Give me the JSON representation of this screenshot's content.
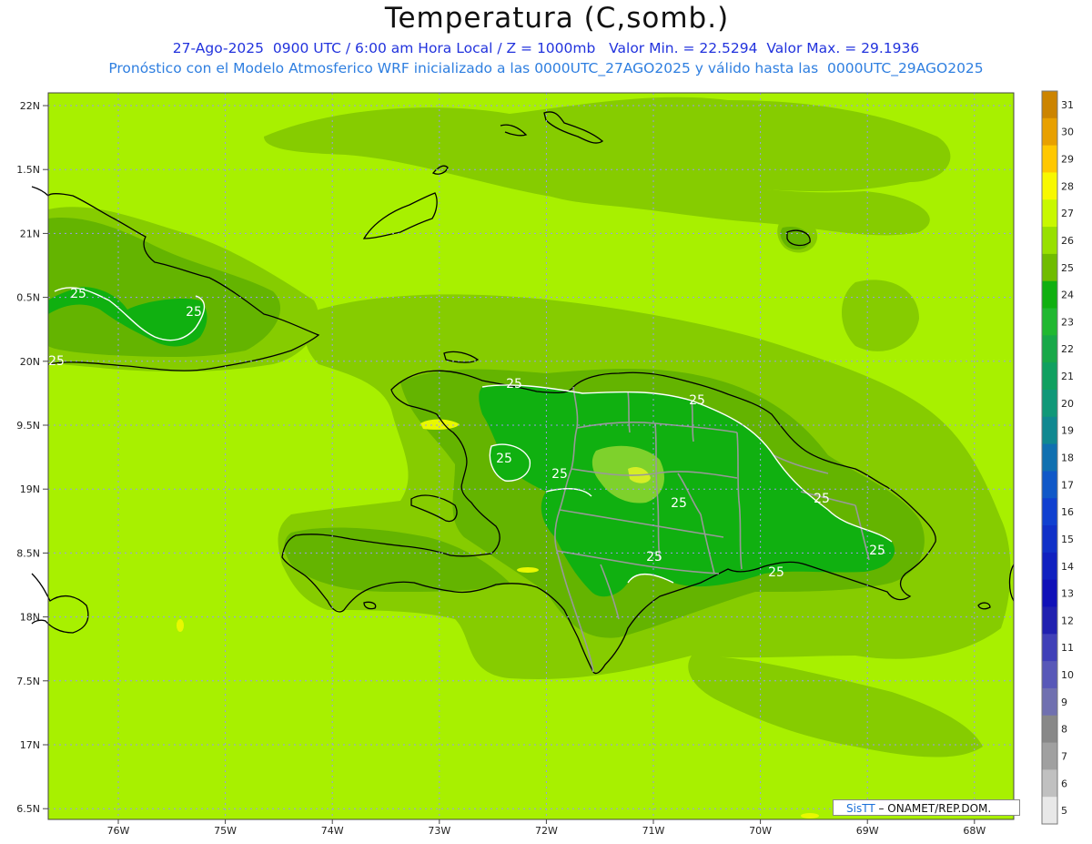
{
  "header": {
    "title": "Temperatura (C,somb.)",
    "line1": "27-Ago-2025  0900 UTC / 6:00 am Hora Local / Z = 1000mb   Valor Min. = 22.5294  Valor Max. = 29.1936",
    "line2": "Pronóstico con el Modelo Atmosferico WRF inicializado a las 0000UTC_27AGO2025 y válido hasta las  0000UTC_29AGO2025"
  },
  "map": {
    "lat_labels": [
      "22N",
      "1.5N",
      "21N",
      "0.5N",
      "20N",
      "9.5N",
      "19N",
      "8.5N",
      "18N",
      "7.5N",
      "17N",
      "6.5N"
    ],
    "lon_labels": [
      "76W",
      "75W",
      "74W",
      "73W",
      "72W",
      "71W",
      "70W",
      "69W",
      "68W"
    ],
    "contour_labels": [
      "25",
      "25",
      "25",
      "25",
      "25",
      "25",
      "25",
      "25",
      "25",
      "25",
      "25",
      "25"
    ],
    "colors": {
      "base": "#a8f000",
      "level25": "#86cc00",
      "level26": "#64b400",
      "level24": "#10b010",
      "warm": "#f0f000",
      "coast": "#000000",
      "border": "#999999"
    }
  },
  "colorbar": {
    "levels": [
      "31",
      "30",
      "29",
      "28",
      "27",
      "26",
      "25",
      "24",
      "23",
      "22",
      "21",
      "20",
      "19",
      "18",
      "17",
      "16",
      "15",
      "14",
      "13",
      "12",
      "11",
      "10",
      "9",
      "8",
      "7",
      "6",
      "5"
    ],
    "colors": [
      "#cc8400",
      "#e8a000",
      "#ffc800",
      "#f8f800",
      "#c8f800",
      "#98e000",
      "#70bc00",
      "#10b010",
      "#20b830",
      "#18a848",
      "#10a060",
      "#109878",
      "#108890",
      "#1070b0",
      "#1058c8",
      "#1040d0",
      "#1030c8",
      "#1020c0",
      "#1010b8",
      "#2020b0",
      "#4040b8",
      "#5858b8",
      "#7070b0",
      "#888888",
      "#a0a0a0",
      "#c0c0c0",
      "#e8e8e8"
    ]
  },
  "credit": {
    "logo": "SisTT",
    "text": "– ONAMET/REP.DOM."
  }
}
